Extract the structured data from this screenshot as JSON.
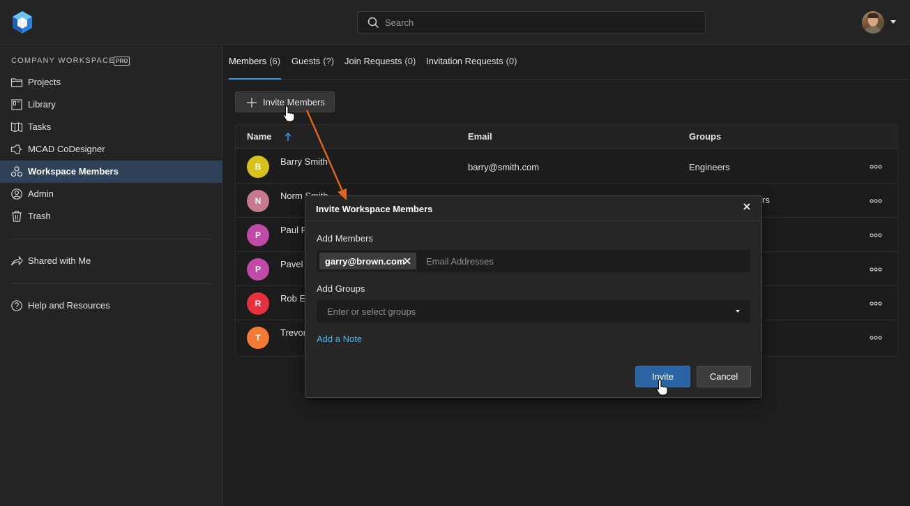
{
  "header": {
    "logo_icon": "workspace-logo-icon",
    "search_placeholder": "Search",
    "user_avatar": "user-avatar"
  },
  "sidebar": {
    "workspace_title": "COMPANY WORKSPACE",
    "badge": "PRO",
    "items": [
      {
        "label": "Projects",
        "icon": "folder-icon"
      },
      {
        "label": "Library",
        "icon": "library-icon"
      },
      {
        "label": "Tasks",
        "icon": "tasks-icon"
      },
      {
        "label": "MCAD CoDesigner",
        "icon": "codesigner-icon"
      },
      {
        "label": "Workspace Members",
        "icon": "members-icon",
        "active": true
      },
      {
        "label": "Admin",
        "icon": "admin-icon"
      },
      {
        "label": "Trash",
        "icon": "trash-icon"
      },
      {
        "label": "Shared with Me",
        "icon": "share-icon"
      },
      {
        "label": "Help and Resources",
        "icon": "help-icon"
      }
    ]
  },
  "tabs": [
    {
      "label": "Members",
      "count": "(6)",
      "active": true
    },
    {
      "label": "Guests",
      "count": "(?)"
    },
    {
      "label": "Join Requests",
      "count": "(0)"
    },
    {
      "label": "Invitation Requests",
      "count": "(0)"
    }
  ],
  "toolbar": {
    "invite_label": "Invite Members"
  },
  "table": {
    "columns": [
      "Name",
      "Email",
      "Groups"
    ],
    "rows": [
      {
        "initial": "B",
        "name": "Barry Smith",
        "email": "barry@smith.com",
        "group": "Engineers",
        "color": "#d6c21a"
      },
      {
        "initial": "N",
        "name": "Norm Smith",
        "email": "",
        "group": "rs",
        "color": "#c77a8e"
      },
      {
        "initial": "P",
        "name": "Paul P",
        "email": "",
        "group": "",
        "color": "#c04aa6"
      },
      {
        "initial": "P",
        "name": "Pavel I",
        "email": "",
        "group": "",
        "color": "#c04aa6"
      },
      {
        "initial": "R",
        "name": "Rob Ev",
        "email": "",
        "group": "",
        "color": "#e8313f"
      },
      {
        "initial": "T",
        "name": "Trevor",
        "email": "",
        "group": "",
        "color": "#f27a35"
      }
    ]
  },
  "modal": {
    "title": "Invite Workspace Members",
    "members_label": "Add Members",
    "member_chip": "garry@brown.com",
    "members_placeholder": "Email Addresses",
    "groups_label": "Add Groups",
    "groups_placeholder": "Enter or select groups",
    "note_link": "Add a Note",
    "invite_button": "Invite",
    "cancel_button": "Cancel"
  },
  "colors": {
    "accent": "#3b9be6",
    "active_nav": "#2f4258",
    "primary_button": "#2b64a3",
    "annotation_arrow": "#e0661b",
    "link": "#4fb3ef"
  }
}
